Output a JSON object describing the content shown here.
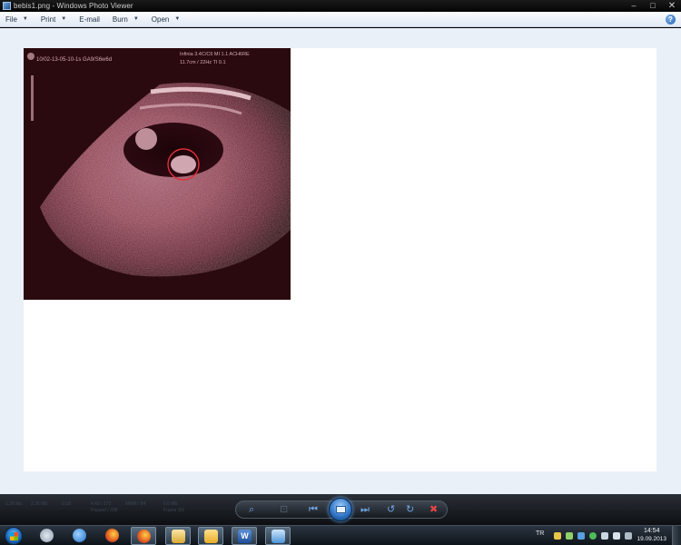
{
  "window": {
    "title": "bebis1.png - Windows Photo Viewer",
    "controls": {
      "minimize": "–",
      "maximize": "□",
      "close": "✕"
    }
  },
  "menu": {
    "items": [
      {
        "label": "File",
        "has_dropdown": true
      },
      {
        "label": "Print",
        "has_dropdown": true
      },
      {
        "label": "E-mail",
        "has_dropdown": false
      },
      {
        "label": "Burn",
        "has_dropdown": true
      },
      {
        "label": "Open",
        "has_dropdown": true
      }
    ],
    "help_label": "?"
  },
  "photo": {
    "header_left": "10/02-13-05-10-1s  GA9/S6w6d",
    "header_right": "Infinia 3.4C/C6    MI 1.1  ACH6RE",
    "header_right2": "11.7cm / 22Hz       TI 0.1",
    "colors": {
      "background": "#2a0a0f",
      "tissue": "#e8b8c2",
      "marker": "#e0303a"
    }
  },
  "controlbar": {
    "readout": [
      "1.28 Mo.",
      "2.35 Mb.",
      "0.18",
      "4.42 / 172",
      "Paused / 398",
      "MMM / 84",
      "6.0 Mb.",
      "Frame 3/3"
    ],
    "icons": {
      "zoom": "⌕",
      "actual_size": "⊡",
      "previous": "⏮",
      "next": "⏭",
      "rotate_ccw": "↺",
      "rotate_cw": "↻",
      "delete": "✖"
    }
  },
  "taskbar": {
    "language": "TR",
    "time": "14:54",
    "date": "19.09.2013",
    "apps": [
      {
        "name": "paint-app",
        "color": "#b9c6d6"
      },
      {
        "name": "internet-explorer",
        "color": "#3a8fe0"
      },
      {
        "name": "firefox",
        "color": "#e2761b"
      },
      {
        "name": "firefox-active",
        "color": "#e2761b"
      },
      {
        "name": "file-explorer",
        "color": "#e8c35a"
      },
      {
        "name": "folder",
        "color": "#f0c64a"
      },
      {
        "name": "word",
        "color": "#2b5ba8"
      },
      {
        "name": "photo-viewer",
        "color": "#5aa7e6"
      }
    ]
  }
}
